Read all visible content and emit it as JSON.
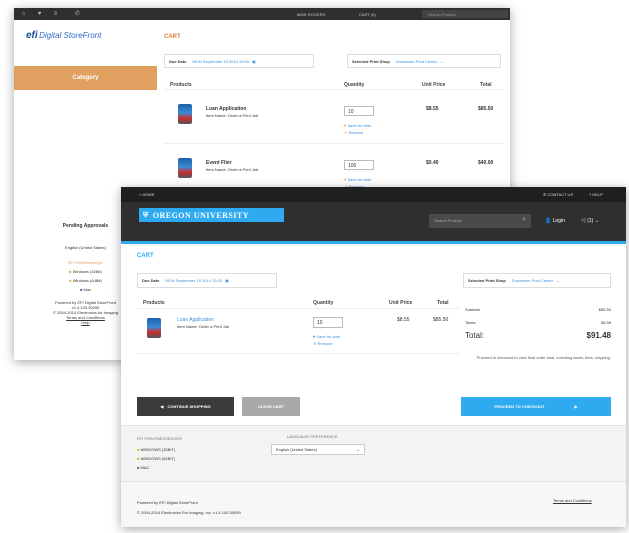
{
  "back": {
    "topbar": {
      "account": "MIKE ROGERS",
      "cart": "CART (0)",
      "search_placeholder": "Search Product"
    },
    "logo": {
      "brand": "efi",
      "title": "Digital StoreFront"
    },
    "sidebar": {
      "category_label": "Category",
      "pending": "Pending Approvals",
      "language": "English (United States)",
      "messenger": "EFI PrintMessenger",
      "win32": "Windows (32Bit)",
      "win64": "Windows (64Bit)",
      "mac": "Mac",
      "powered": "Powered by EFI Digital StoreFront",
      "version": "v1.4.100.30090",
      "copyright": "© 2004-2014 Electronics for Imaging",
      "terms": "Terms and Conditions",
      "help": "Help"
    },
    "page_title": "CART",
    "due_label": "Due Date",
    "due_value": "MON September 15 2014 13:00",
    "shop_label": "Selected Print Shop",
    "shop_value": "Downtown Print Center",
    "columns": {
      "products": "Products",
      "quantity": "Quantity",
      "unit_price": "Unit Price",
      "total": "Total"
    },
    "items": [
      {
        "name": "Loan Application",
        "sub": "Item Name: Order a Print Job",
        "qty": "10",
        "unit": "$8.55",
        "total": "$85.50",
        "save": "Save for later",
        "remove": "Remove"
      },
      {
        "name": "Event Flier",
        "sub": "Item Name: Order a Print Job",
        "qty": "100",
        "unit": "$0.40",
        "total": "$40.00",
        "save": "Save for later",
        "remove": "Remove"
      }
    ]
  },
  "front": {
    "topbar": {
      "home": "HOME",
      "contact": "CONTACT US",
      "help": "HELP"
    },
    "header": {
      "university": "OREGON UNIVERSITY",
      "search_placeholder": "Search Product",
      "login": "Login",
      "cart": "(1)"
    },
    "page_title": "CART",
    "due_label": "Due Date",
    "due_value": "MON September 15 2014 13:00",
    "shop_label": "Selected Print Shop",
    "shop_value": "Downtown Print Center",
    "columns": {
      "products": "Products",
      "quantity": "Quantity",
      "unit_price": "Unit Price",
      "total": "Total"
    },
    "item": {
      "name": "Loan Application",
      "sub": "Item Name: Order a Print Job",
      "qty": "10",
      "unit": "$8.55",
      "total": "$85.50",
      "save": "Save for later",
      "remove": "Remove"
    },
    "summary": {
      "subtotal_label": "Subtotal",
      "subtotal_value": "$85.50",
      "taxes_label": "Taxes",
      "taxes_value": "$5.98",
      "total_label": "Total:",
      "total_value": "$91.48",
      "note": "Proceed to checkout to view final order total, including taxes, fees, shipping."
    },
    "buttons": {
      "continue": "CONTINUE SHOPPING",
      "clear": "CLEAR CART",
      "checkout": "PROCEED TO CHECKOUT"
    },
    "footer": {
      "messenger": "EFI PRINTMESSENGER",
      "win32": "WINDOWS (32BIT)",
      "win64": "WINDOWS (64BIT)",
      "mac": "MAC",
      "lang_label": "LANGUAGE PREFERENCE",
      "lang_value": "English (United States)",
      "powered": "Powered by EFI Digital StoreFront",
      "copyright": "© 2004-2014 Electronics For Imaging, Inc.   v1.4.100.30090",
      "terms": "Terms and Conditions"
    }
  },
  "colors": {
    "accent_orange": "#e0a060",
    "accent_blue": "#2eaaf0",
    "dark_header": "#2f2f2f",
    "link_blue": "#3a8fd9"
  }
}
